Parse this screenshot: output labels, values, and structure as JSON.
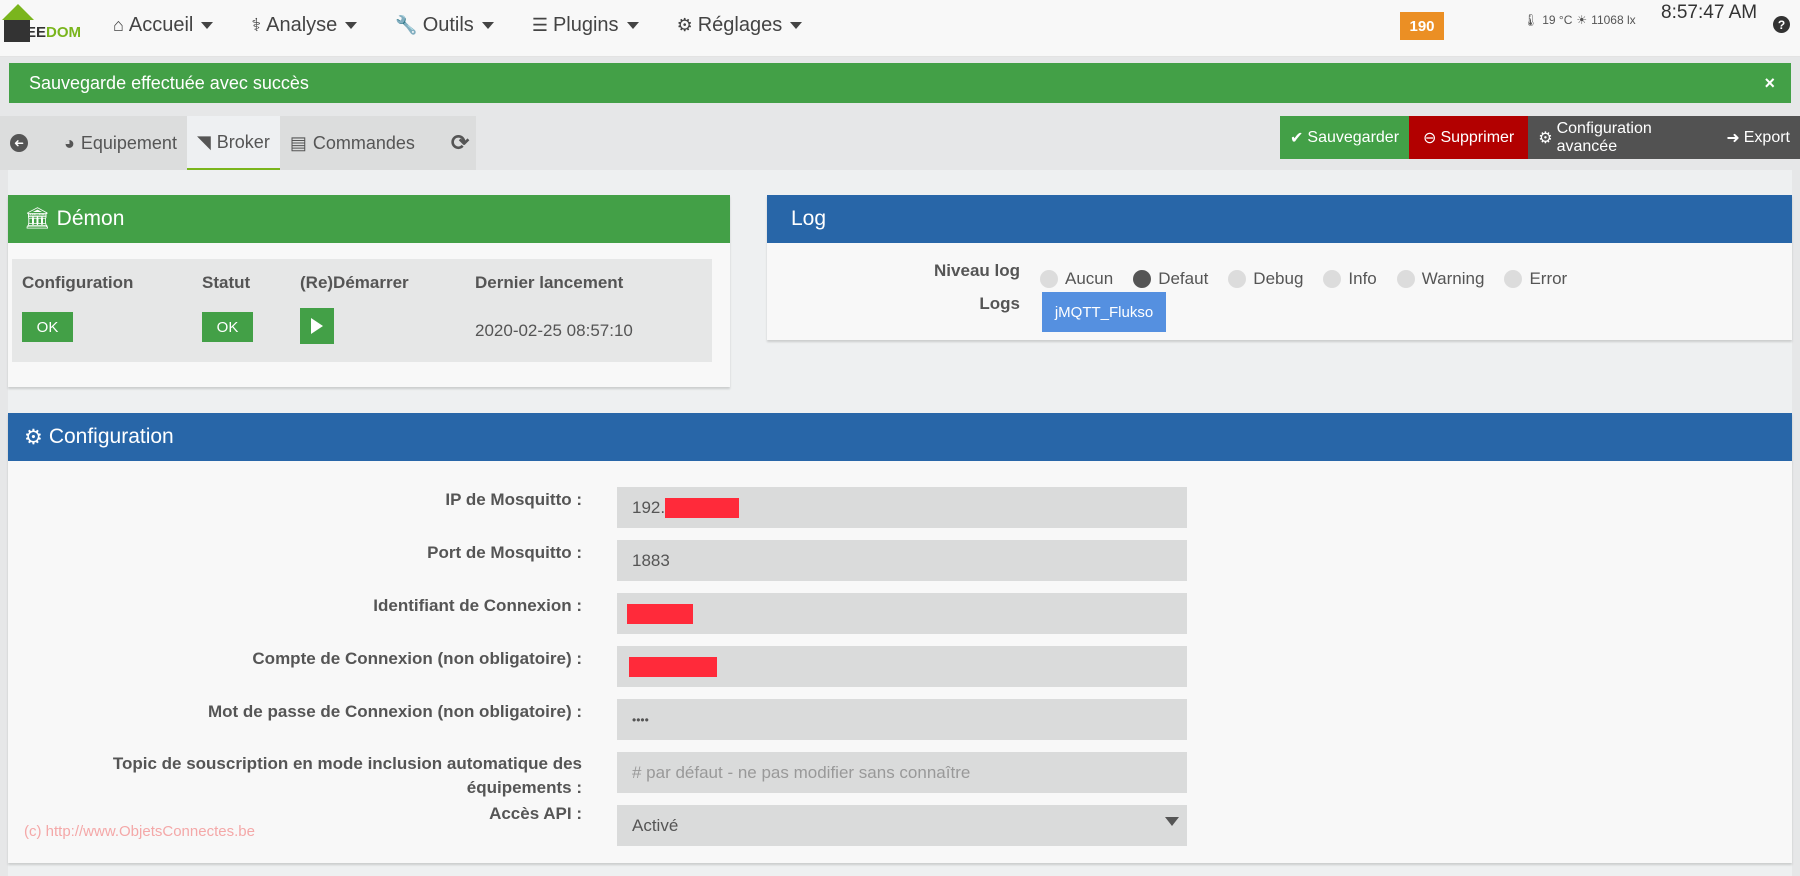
{
  "topbar": {
    "logo_prefix": "EE",
    "logo_suffix": "DOM",
    "nav": [
      {
        "icon": "home-icon",
        "glyph": "⌂",
        "label": "Accueil"
      },
      {
        "icon": "stethoscope-icon",
        "glyph": "⚕",
        "label": "Analyse"
      },
      {
        "icon": "wrench-icon",
        "glyph": "🔧",
        "label": "Outils"
      },
      {
        "icon": "tasks-icon",
        "glyph": "☰",
        "label": "Plugins"
      },
      {
        "icon": "cog-icon",
        "glyph": "⚙",
        "label": "Réglages"
      }
    ],
    "badge": "190",
    "temperature": "19 °C",
    "luminosity": "11068 lx",
    "clock": "8:57:47 AM",
    "help": "?"
  },
  "alert": {
    "message": "Sauvegarde effectuée avec succès",
    "close": "×",
    "color": "#43a047"
  },
  "tabs": {
    "back": "➜",
    "items": [
      {
        "label": "Equipement",
        "icon": "tachometer-icon",
        "active": false
      },
      {
        "label": "Broker",
        "icon": "rss-icon",
        "active": true
      },
      {
        "label": "Commandes",
        "icon": "list-icon",
        "active": false
      }
    ],
    "refresh": "⟳"
  },
  "actions": {
    "save": "Sauvegarder",
    "delete": "Supprimer",
    "advanced": "Configuration avancée",
    "export": "Export"
  },
  "demon": {
    "title": "Démon",
    "headers": [
      "Configuration",
      "Statut",
      "(Re)Démarrer",
      "Dernier lancement"
    ],
    "configuration": "OK",
    "status": "OK",
    "last_launch": "2020-02-25 08:57:10"
  },
  "log": {
    "title": "Log",
    "level_label": "Niveau log",
    "levels": [
      {
        "label": "Aucun",
        "selected": false
      },
      {
        "label": "Defaut",
        "selected": true
      },
      {
        "label": "Debug",
        "selected": false
      },
      {
        "label": "Info",
        "selected": false
      },
      {
        "label": "Warning",
        "selected": false
      },
      {
        "label": "Error",
        "selected": false
      }
    ],
    "logs_label": "Logs",
    "log_button": "jMQTT_Flukso"
  },
  "config": {
    "title": "Configuration",
    "fields": [
      {
        "label": "IP de Mosquitto :",
        "value": "192.",
        "redacted": true
      },
      {
        "label": "Port de Mosquitto :",
        "value": "1883"
      },
      {
        "label": "Identifiant de Connexion :",
        "value": "",
        "redacted": true
      },
      {
        "label": "Compte de Connexion (non obligatoire) :",
        "value": "",
        "redacted": true
      },
      {
        "label": "Mot de passe de Connexion (non obligatoire) :",
        "value": "••••"
      },
      {
        "label": "Topic de souscription en mode inclusion automatique des équipements :",
        "value": "",
        "placeholder": "# par défaut - ne pas modifier sans connaître"
      },
      {
        "label": "Accès API :",
        "value": "Activé",
        "select": true
      }
    ]
  },
  "watermark": "(c) http://www.ObjetsConnectes.be"
}
